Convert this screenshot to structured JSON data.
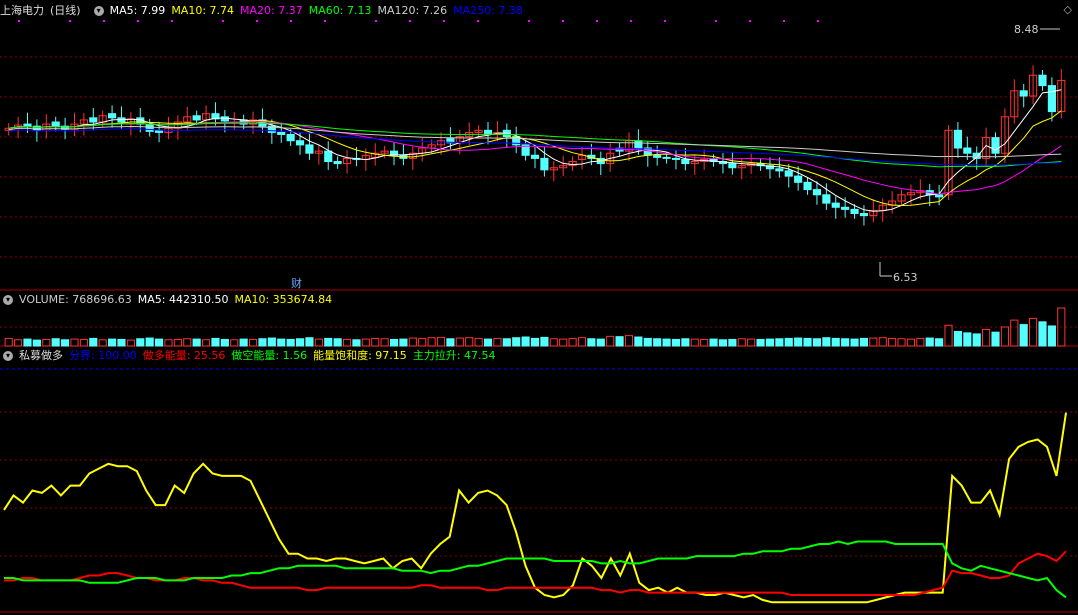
{
  "main_panel": {
    "stock_name": "上海电力",
    "period": "(日线)",
    "ma_items": [
      {
        "label": "MA5: 7.99",
        "color": "#ffffff"
      },
      {
        "label": "MA10: 7.74",
        "color": "#ffff00"
      },
      {
        "label": "MA20: 7.37",
        "color": "#ff00ff"
      },
      {
        "label": "MA60: 7.13",
        "color": "#00ff00"
      },
      {
        "label": "MA120: 7.26",
        "color": "#cccccc"
      },
      {
        "label": "MA250: 7.38",
        "color": "#0000ff"
      }
    ],
    "high_label": "8.48",
    "low_label": "6.53",
    "event_marker": "财",
    "corner_icon": "diamond-icon"
  },
  "volume_panel": {
    "items": [
      {
        "label": "VOLUME: 768696.63",
        "color": "#cccccc"
      },
      {
        "label": "MA5: 442310.50",
        "color": "#ffffff"
      },
      {
        "label": "MA10: 353674.84",
        "color": "#ffff00"
      }
    ]
  },
  "indicator_panel": {
    "name": "私募做多",
    "items": [
      {
        "label": "分界: 100.00",
        "color": "#0000ff"
      },
      {
        "label": "做多能量: 25.56",
        "color": "#ff0000"
      },
      {
        "label": "做空能量: 1.56",
        "color": "#00ff00"
      },
      {
        "label": "能量饱和度: 97.15",
        "color": "#ffff00"
      },
      {
        "label": "主力拉升: 47.54",
        "color": "#00ff00"
      }
    ]
  },
  "colors": {
    "up": "#ff3232",
    "down": "#54ffff",
    "grid": "#8b0000",
    "border": "#b00000"
  },
  "chart_data": [
    {
      "type": "candlestick",
      "title": "上海电力 (日线)",
      "ylim": [
        6.3,
        8.8
      ],
      "close": [
        7.74,
        7.77,
        7.76,
        7.72,
        7.78,
        7.76,
        7.73,
        7.78,
        7.82,
        7.8,
        7.86,
        7.84,
        7.8,
        7.83,
        7.78,
        7.71,
        7.7,
        7.74,
        7.8,
        7.85,
        7.82,
        7.88,
        7.83,
        7.81,
        7.8,
        7.78,
        7.82,
        7.76,
        7.7,
        7.68,
        7.62,
        7.58,
        7.5,
        7.52,
        7.42,
        7.4,
        7.45,
        7.44,
        7.48,
        7.5,
        7.52,
        7.48,
        7.45,
        7.5,
        7.55,
        7.58,
        7.62,
        7.6,
        7.66,
        7.7,
        7.72,
        7.68,
        7.7,
        7.66,
        7.58,
        7.48,
        7.45,
        7.34,
        7.36,
        7.38,
        7.42,
        7.48,
        7.45,
        7.4,
        7.5,
        7.52,
        7.62,
        7.55,
        7.48,
        7.46,
        7.45,
        7.44,
        7.4,
        7.42,
        7.44,
        7.42,
        7.4,
        7.36,
        7.38,
        7.4,
        7.38,
        7.35,
        7.33,
        7.28,
        7.22,
        7.15,
        7.1,
        7.02,
        6.98,
        6.96,
        6.92,
        6.9,
        6.95,
        7.0,
        7.04,
        7.1,
        7.12,
        7.14,
        7.1,
        7.08,
        7.72,
        7.55,
        7.5,
        7.45,
        7.65,
        7.5,
        7.85,
        8.1,
        8.05,
        8.25,
        8.15,
        7.9,
        8.2
      ],
      "open": [
        7.72,
        7.74,
        7.78,
        7.76,
        7.72,
        7.8,
        7.76,
        7.73,
        7.78,
        7.84,
        7.8,
        7.88,
        7.84,
        7.78,
        7.84,
        7.78,
        7.72,
        7.7,
        7.74,
        7.8,
        7.86,
        7.82,
        7.88,
        7.85,
        7.8,
        7.82,
        7.78,
        7.82,
        7.76,
        7.7,
        7.68,
        7.62,
        7.58,
        7.5,
        7.52,
        7.42,
        7.4,
        7.45,
        7.44,
        7.46,
        7.5,
        7.52,
        7.48,
        7.45,
        7.5,
        7.55,
        7.58,
        7.64,
        7.6,
        7.66,
        7.7,
        7.72,
        7.68,
        7.72,
        7.66,
        7.58,
        7.48,
        7.45,
        7.34,
        7.36,
        7.38,
        7.44,
        7.48,
        7.45,
        7.4,
        7.55,
        7.52,
        7.62,
        7.55,
        7.48,
        7.46,
        7.45,
        7.44,
        7.4,
        7.42,
        7.44,
        7.42,
        7.4,
        7.36,
        7.38,
        7.4,
        7.38,
        7.35,
        7.33,
        7.28,
        7.22,
        7.15,
        7.1,
        7.02,
        6.98,
        6.96,
        6.92,
        6.9,
        6.95,
        7.0,
        7.04,
        7.1,
        7.12,
        7.14,
        7.1,
        7.1,
        7.72,
        7.55,
        7.5,
        7.45,
        7.65,
        7.5,
        7.85,
        8.1,
        8.05,
        8.25,
        8.15,
        7.9
      ],
      "volume": [
        22,
        18,
        20,
        17,
        19,
        21,
        18,
        20,
        19,
        22,
        18,
        20,
        19,
        17,
        21,
        23,
        20,
        18,
        19,
        21,
        20,
        18,
        22,
        19,
        18,
        20,
        19,
        21,
        23,
        20,
        19,
        21,
        24,
        20,
        22,
        21,
        19,
        18,
        20,
        22,
        21,
        19,
        20,
        23,
        22,
        24,
        25,
        21,
        23,
        24,
        22,
        20,
        22,
        21,
        24,
        26,
        22,
        25,
        21,
        20,
        22,
        24,
        21,
        20,
        28,
        27,
        30,
        26,
        22,
        21,
        20,
        19,
        21,
        20,
        19,
        20,
        18,
        19,
        21,
        20,
        19,
        20,
        21,
        22,
        23,
        22,
        21,
        24,
        22,
        21,
        20,
        22,
        23,
        24,
        22,
        21,
        20,
        22,
        23,
        21,
        60,
        42,
        38,
        35,
        48,
        40,
        55,
        75,
        62,
        80,
        70,
        58,
        110
      ]
    },
    {
      "type": "line",
      "title": "私募做多",
      "ylim": [
        0,
        100
      ],
      "series": [
        {
          "name": "能量饱和度",
          "color": "#ffff00",
          "values": [
            42,
            48,
            45,
            50,
            49,
            52,
            48,
            52,
            52,
            57,
            59,
            61,
            60,
            60,
            58,
            50,
            44,
            44,
            52,
            49,
            57,
            61,
            57,
            56,
            56,
            56,
            54,
            46,
            38,
            30,
            24,
            24,
            22,
            22,
            21,
            22,
            22,
            21,
            20,
            21,
            22,
            18,
            21,
            22,
            18,
            24,
            28,
            31,
            50,
            45,
            49,
            50,
            48,
            44,
            33,
            19,
            10,
            7,
            6,
            7,
            11,
            22,
            19,
            14,
            22,
            15,
            24,
            12,
            9,
            10,
            8,
            10,
            8,
            8,
            7,
            7,
            8,
            7,
            6,
            7,
            5,
            4,
            4,
            4,
            4,
            4,
            4,
            4,
            4,
            4,
            4,
            4,
            5,
            6,
            7,
            8,
            8,
            8,
            8,
            8,
            56,
            52,
            45,
            45,
            50,
            40,
            63,
            68,
            70,
            71,
            68,
            56,
            82
          ]
        },
        {
          "name": "做多能量",
          "color": "#ff0000",
          "values": [
            13,
            13,
            14,
            14,
            13,
            13,
            13,
            13,
            14,
            15,
            15,
            16,
            16,
            15,
            14,
            14,
            13,
            13,
            13,
            14,
            14,
            13,
            13,
            12,
            12,
            11,
            10,
            10,
            10,
            10,
            10,
            10,
            9,
            9,
            10,
            10,
            10,
            10,
            10,
            10,
            10,
            10,
            10,
            10,
            11,
            11,
            10,
            10,
            10,
            10,
            10,
            9,
            9,
            10,
            10,
            10,
            10,
            10,
            10,
            10,
            10,
            10,
            10,
            9,
            9,
            8,
            9,
            9,
            8,
            8,
            8,
            8,
            8,
            8,
            8,
            8,
            8,
            8,
            8,
            8,
            8,
            8,
            8,
            7,
            7,
            7,
            7,
            7,
            7,
            7,
            7,
            7,
            7,
            7,
            7,
            7,
            7,
            8,
            9,
            10,
            17,
            16,
            16,
            15,
            14,
            14,
            15,
            20,
            22,
            24,
            23,
            21,
            25
          ]
        },
        {
          "name": "做空能量",
          "color": "#00ff00",
          "values": [
            14,
            14,
            13,
            13,
            13,
            13,
            13,
            13,
            13,
            12,
            12,
            12,
            12,
            13,
            14,
            14,
            14,
            13,
            13,
            13,
            14,
            14,
            14,
            14,
            15,
            15,
            16,
            16,
            17,
            18,
            18,
            19,
            19,
            19,
            19,
            19,
            18,
            18,
            18,
            18,
            18,
            18,
            17,
            17,
            17,
            16,
            17,
            17,
            18,
            19,
            19,
            20,
            21,
            22,
            22,
            22,
            22,
            22,
            21,
            21,
            21,
            21,
            21,
            20,
            20,
            21,
            20,
            20,
            21,
            22,
            22,
            22,
            22,
            23,
            23,
            23,
            23,
            23,
            24,
            24,
            25,
            25,
            25,
            26,
            26,
            27,
            28,
            28,
            29,
            28,
            29,
            29,
            29,
            29,
            28,
            28,
            28,
            28,
            28,
            28,
            20,
            18,
            17,
            19,
            18,
            17,
            16,
            15,
            14,
            13,
            14,
            9,
            6
          ]
        }
      ]
    }
  ]
}
